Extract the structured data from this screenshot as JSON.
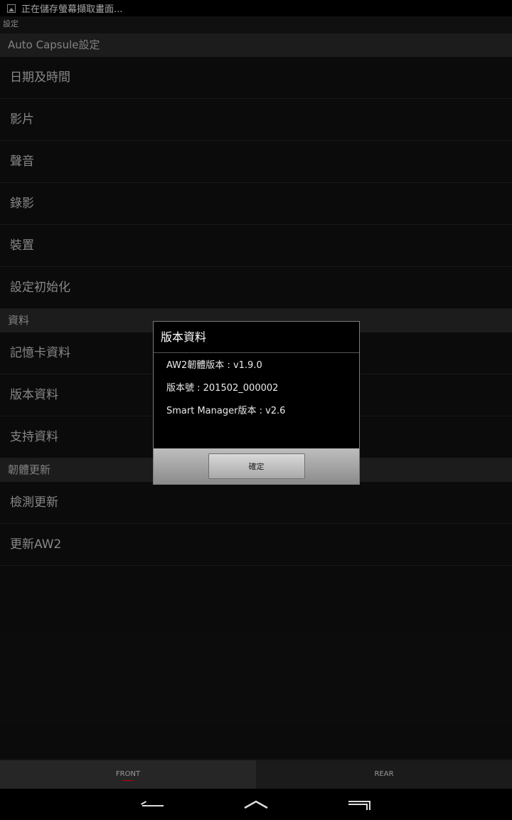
{
  "status_bar": {
    "notification_icon": "image-icon",
    "text": "正在儲存螢幕擷取畫面..."
  },
  "title_bar": {
    "title": "設定"
  },
  "sections": [
    {
      "header": "Auto Capsule設定",
      "items": [
        "日期及時間",
        "影片",
        "聲音",
        "錄影",
        "裝置",
        "設定初始化"
      ]
    },
    {
      "header": "資料",
      "items": [
        "記憶卡資料",
        "版本資料",
        "支持資料"
      ]
    },
    {
      "header": "韌體更新",
      "items": [
        "檢測更新",
        "更新AW2"
      ]
    }
  ],
  "dialog": {
    "title": "版本資料",
    "lines": [
      "AW2韌體版本 : v1.9.0",
      "版本號 : 201502_000002",
      "Smart Manager版本 : v2.6"
    ],
    "ok_label": "確定"
  },
  "bottom_tabs": [
    {
      "label": "FRONT",
      "active": true
    },
    {
      "label": "REAR",
      "active": false
    }
  ],
  "nav_bar": {
    "icons": [
      "back-icon",
      "home-icon",
      "recent-apps-icon"
    ]
  },
  "colors": {
    "background": "#121212",
    "section_header": "#2b2b2b",
    "dialog_bg": "#000000"
  }
}
